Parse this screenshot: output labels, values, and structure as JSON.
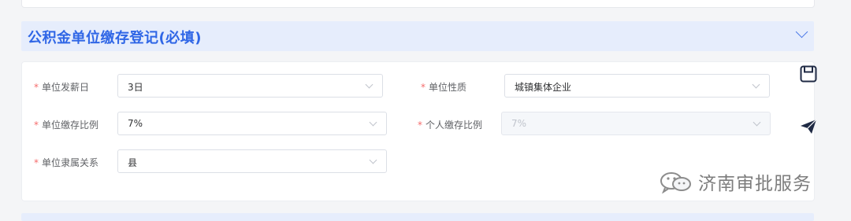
{
  "section": {
    "title": "公积金单位缴存登记(必填)"
  },
  "form": {
    "required_mark": "*",
    "fields": [
      {
        "label": "单位发薪日",
        "value": "3日"
      },
      {
        "label": "单位性质",
        "value": "城镇集体企业"
      },
      {
        "label": "单位缴存比例",
        "value": "7%"
      },
      {
        "label": "个人缴存比例",
        "value": "7%",
        "disabled": true
      },
      {
        "label": "单位隶属关系",
        "value": "县"
      }
    ]
  },
  "side_actions": {
    "icons": [
      "save-icon",
      "send-icon"
    ]
  },
  "watermark": {
    "text": "济南审批服务"
  },
  "colors": {
    "accent": "#2f66e6",
    "header_bg": "#e6edfc",
    "required": "#f56c6c"
  }
}
